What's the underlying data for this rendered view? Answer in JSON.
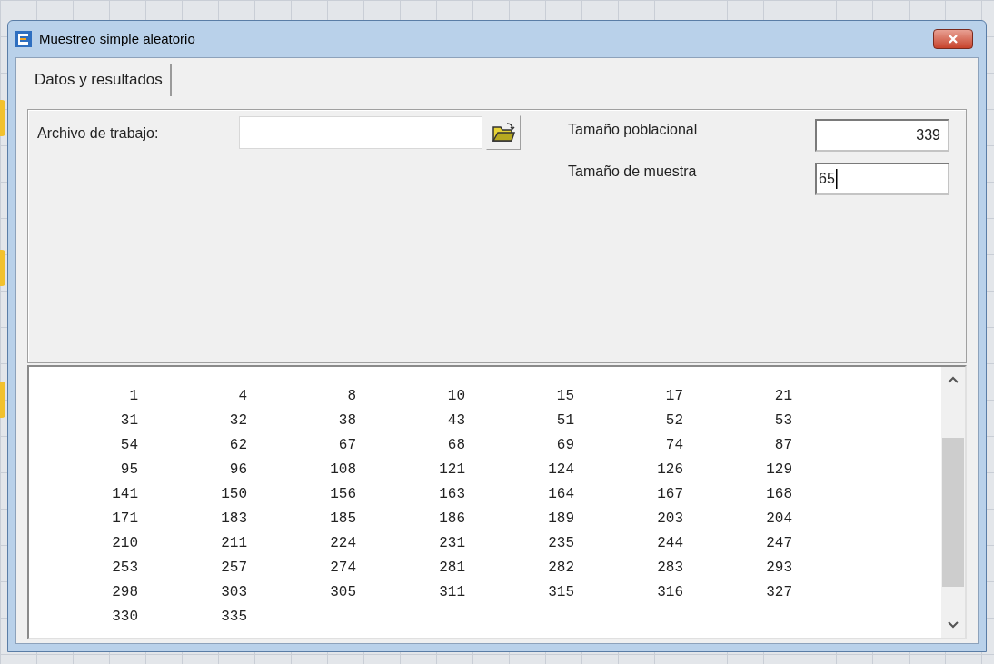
{
  "window": {
    "title": "Muestreo simple aleatorio"
  },
  "tabs": [
    {
      "label": "Datos y resultados",
      "selected": true
    }
  ],
  "file_field": {
    "label": "Archivo de trabajo:"
  },
  "population_size": {
    "label": "Tamaño poblacional",
    "value": "339"
  },
  "sample_size": {
    "label": "Tamaño de muestra",
    "value": "65",
    "focused": true
  },
  "results": [
    [
      "1",
      "4",
      "8",
      "10",
      "15",
      "17",
      "21"
    ],
    [
      "31",
      "32",
      "38",
      "43",
      "51",
      "52",
      "53"
    ],
    [
      "54",
      "62",
      "67",
      "68",
      "69",
      "74",
      "87"
    ],
    [
      "95",
      "96",
      "108",
      "121",
      "124",
      "126",
      "129"
    ],
    [
      "141",
      "150",
      "156",
      "163",
      "164",
      "167",
      "168"
    ],
    [
      "171",
      "183",
      "185",
      "186",
      "189",
      "203",
      "204"
    ],
    [
      "210",
      "211",
      "224",
      "231",
      "235",
      "244",
      "247"
    ],
    [
      "253",
      "257",
      "274",
      "281",
      "282",
      "283",
      "293"
    ],
    [
      "298",
      "303",
      "305",
      "311",
      "315",
      "316",
      "327"
    ],
    [
      "330",
      "335"
    ]
  ]
}
